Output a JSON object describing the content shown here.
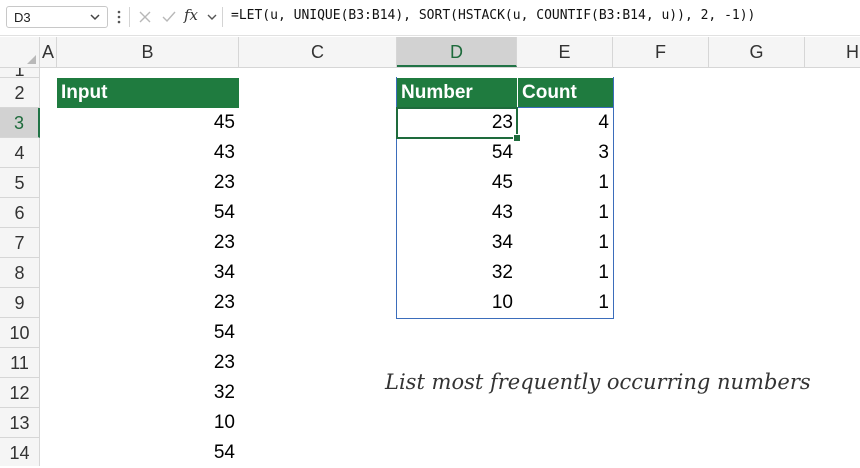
{
  "formula_bar": {
    "name_box": "D3",
    "fx_label": "fx",
    "formula": "=LET(u, UNIQUE(B3:B14), SORT(HSTACK(u, COUNTIF(B3:B14, u)), 2, -1))"
  },
  "columns": [
    "A",
    "B",
    "C",
    "D",
    "E",
    "F",
    "G",
    "H"
  ],
  "rows": [
    "1",
    "2",
    "3",
    "4",
    "5",
    "6",
    "7",
    "8",
    "9",
    "10",
    "11",
    "12",
    "13",
    "14"
  ],
  "input_table": {
    "header": "Input",
    "values": [
      "45",
      "43",
      "23",
      "54",
      "23",
      "34",
      "23",
      "54",
      "23",
      "32",
      "10",
      "54"
    ]
  },
  "result_table": {
    "headers": [
      "Number",
      "Count"
    ],
    "rows": [
      [
        "23",
        "4"
      ],
      [
        "54",
        "3"
      ],
      [
        "45",
        "1"
      ],
      [
        "43",
        "1"
      ],
      [
        "34",
        "1"
      ],
      [
        "32",
        "1"
      ],
      [
        "10",
        "1"
      ]
    ]
  },
  "note": "List most frequently occurring numbers",
  "colors": {
    "header_fill": "#1f7b3f",
    "selection": "#1e6b3c",
    "table_border": "#3b6dbb"
  }
}
